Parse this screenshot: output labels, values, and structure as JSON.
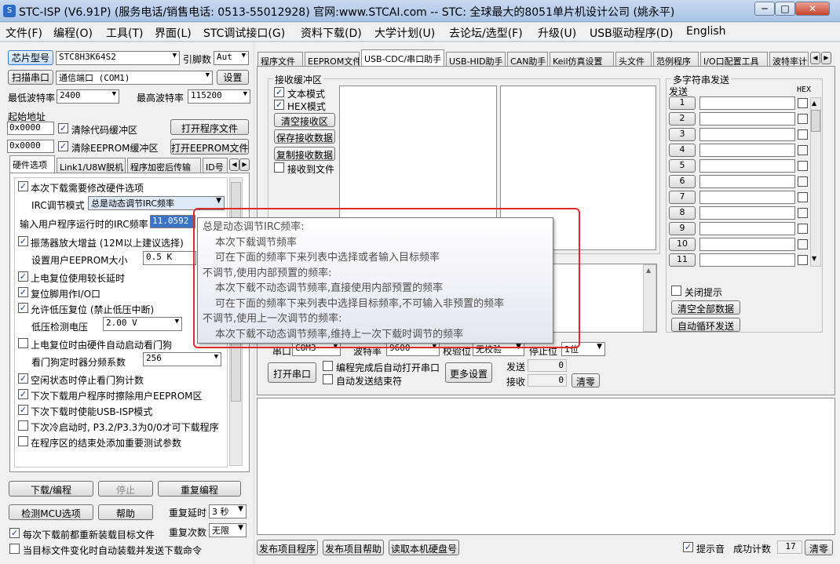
{
  "window": {
    "title": "STC-ISP (V6.91P) (服务电话/销售电话: 0513-55012928) 官网:www.STCAI.com  -- STC: 全球最大的8051单片机设计公司 (姚永平)",
    "min": "─",
    "max": "□",
    "close": "✕"
  },
  "menu": [
    "文件(F)",
    "编程(O)",
    "工具(T)",
    "界面(L)",
    "STC调试接口(G)",
    "资料下载(D)",
    "大学计划(U)",
    "去论坛/选型(F)",
    "升级(U)",
    "USB驱动程序(D)",
    "English"
  ],
  "left": {
    "chip_btn": "芯片型号",
    "chip_value": "STC8H3K64S2",
    "pin_label": "引脚数",
    "pin_value": "Aut",
    "scan_btn": "扫描串口",
    "port_value": "通信端口 (COM1)",
    "settings_btn": "设置",
    "min_baud_label": "最低波特率",
    "min_baud": "2400",
    "max_baud_label": "最高波特率",
    "max_baud": "115200",
    "start_addr": "起始地址",
    "addr1": "0x0000",
    "clear_code": "清除代码缓冲区",
    "open_prog": "打开程序文件",
    "addr2": "0x0000",
    "clear_eeprom": "清除EEPROM缓冲区",
    "open_eeprom": "打开EEPROM文件",
    "tabs": [
      "硬件选项",
      "Link1/U8W脱机",
      "程序加密后传输",
      "ID号"
    ],
    "hw": {
      "modify_hw": "本次下载需要修改硬件选项",
      "irc_label": "IRC调节模式",
      "irc_value": "总是动态调节IRC频率",
      "freq_label": "输入用户程序运行时的IRC频率",
      "freq_value": "11.0592",
      "osc_gain": "振荡器放大增益 (12M以上建议选择)",
      "eeprom_size_label": "设置用户EEPROM大小",
      "eeprom_size": "0.5 K",
      "por_delay": "上电复位使用较长延时",
      "reset_io": "复位脚用作I/O口",
      "lvr": "允许低压复位 (禁止低压中断)",
      "lvd_label": "低压检测电压",
      "lvd": "2.00 V",
      "wdt_auto": "上电复位时由硬件自动启动看门狗",
      "wdt_div_label": "看门狗定时器分频系数",
      "wdt_div": "256",
      "idle_wdt": "空闲状态时停止看门狗计数",
      "erase_eeprom": "下次下载用户程序时擦除用户EEPROM区",
      "usb_isp": "下次下载时使能USB-ISP模式",
      "cold_boot": "下次冷启动时, P3.2/P3.3为0/0才可下载程序",
      "add_params": "在程序区的结束处添加重要测试参数"
    },
    "download_btn": "下载/编程",
    "stop_btn": "停止",
    "reprogram_btn": "重复编程",
    "detect_btn": "检测MCU选项",
    "help_btn": "帮助",
    "repeat_delay_label": "重复延时",
    "repeat_delay": "3 秒",
    "repeat_count_label": "重复次数",
    "repeat_count": "无限",
    "reload_before": "每次下载前都重新装载目标文件",
    "auto_on_change": "当目标文件变化时自动装载并发送下载命令"
  },
  "right": {
    "tabs": [
      "程序文件",
      "EEPROM文件",
      "USB-CDC/串口助手",
      "USB-HID助手",
      "CAN助手",
      "Keil仿真设置",
      "头文件",
      "范例程序",
      "I/O口配置工具",
      "波特率计"
    ],
    "recv_group": "接收缓冲区",
    "text_mode": "文本模式",
    "hex_mode": "HEX模式",
    "clear_recv": "清空接收区",
    "save_recv": "保存接收数据",
    "copy_recv": "复制接收数据",
    "recv_to_file": "接收到文件",
    "multi_title": "多字符串发送",
    "send_col": "发送",
    "hex_col": "HEX",
    "rows": [
      "1",
      "2",
      "3",
      "4",
      "5",
      "6",
      "7",
      "8",
      "9",
      "10",
      "11"
    ],
    "close_tip": "关闭提示",
    "clear_all": "清空全部数据",
    "auto_loop": "自动循环发送",
    "port_label": "串口",
    "port_val": "COM3",
    "baud_label": "波特率",
    "baud_val": "9600",
    "parity_label": "校验位",
    "parity_val": "无校验",
    "stop_label": "停止位",
    "stop_val": "1位",
    "open_port": "打开串口",
    "auto_open": "编程完成后自动打开串口",
    "auto_send_end": "自动发送结束符",
    "more_settings": "更多设置",
    "send_label": "发送",
    "send_count": "0",
    "recv_label": "接收",
    "recv_count": "0",
    "clear_count": "清零",
    "publish_prog": "发布项目程序",
    "publish_help": "发布项目帮助",
    "read_disk": "读取本机硬盘号",
    "beep": "提示音",
    "success_label": "成功计数",
    "success_count": "17",
    "clear_success": "清零"
  },
  "tooltip": [
    "总是动态调节IRC频率:",
    "本次下载调节频率",
    "可在下面的频率下来列表中选择或者输入目标频率",
    "不调节,使用内部预置的频率:",
    "本次下载不动态调节频率,直接使用内部预置的频率",
    "可在下面的频率下来列表中选择目标频率,不可输入非预置的频率",
    "不调节,使用上一次调节的频率:",
    "本次下载不动态调节频率,维持上一次下载时调节的频率"
  ]
}
